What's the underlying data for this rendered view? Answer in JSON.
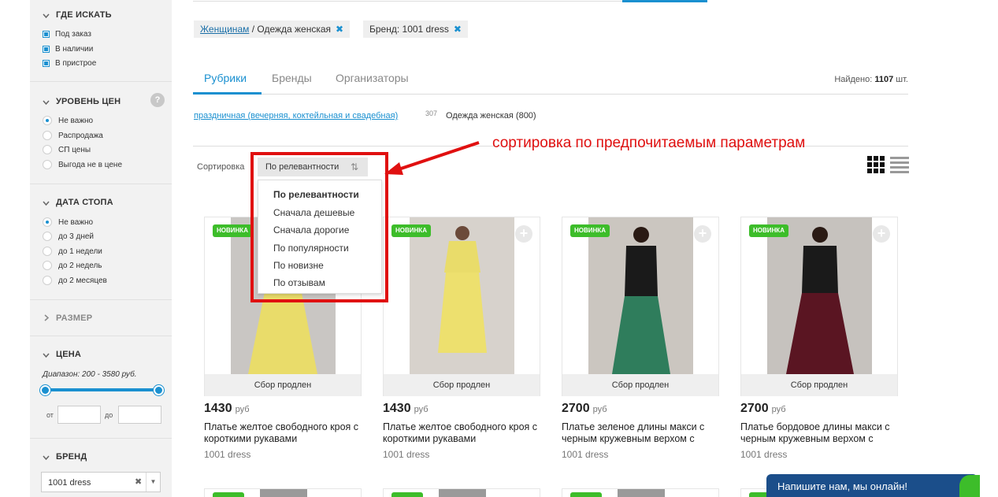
{
  "sidebar": {
    "where": {
      "title": "ГДЕ ИСКАТЬ",
      "options": [
        "Под заказ",
        "В наличии",
        "В пристрое"
      ]
    },
    "price_level": {
      "title": "УРОВЕНЬ ЦЕН",
      "help": "?",
      "options": [
        "Не важно",
        "Распродажа",
        "СП цены",
        "Выгода не в цене"
      ]
    },
    "stop_date": {
      "title": "ДАТА СТОПА",
      "options": [
        "Не важно",
        "до 3 дней",
        "до 1 недели",
        "до 2 недель",
        "до 2 месяцев"
      ]
    },
    "size": {
      "title": "РАЗМЕР"
    },
    "price": {
      "title": "ЦЕНА",
      "range": "Диапазон: 200 - 3580 руб.",
      "from": "от",
      "to": "до"
    },
    "brand": {
      "title": "БРЕНД",
      "value": "1001 dress",
      "clear": "✖",
      "dropdown": "▼"
    }
  },
  "filters": {
    "chip1_link": "Женщинам",
    "chip1_rest": " / Одежда женская",
    "chip2": "Бренд: 1001 dress",
    "remove": "✖"
  },
  "tabs": [
    "Рубрики",
    "Бренды",
    "Организаторы"
  ],
  "found": {
    "label": "Найдено: ",
    "count": "1107",
    "unit": " шт."
  },
  "rubrics": {
    "link": "праздничная (вечерняя, коктейльная и свадебная)",
    "count": "307",
    "plain": "Одежда женская (800)"
  },
  "sort": {
    "label": "Сортировка",
    "current": "По релевантности",
    "icon": "⇅",
    "options": [
      "По релевантности",
      "Сначала дешевые",
      "Сначала дорогие",
      "По популярности",
      "По новизне",
      "По отзывам"
    ]
  },
  "annotation": "сортировка по предпочитаемым параметрам",
  "products": [
    {
      "badge": "НОВИНКА",
      "footer": "Сбор продлен",
      "price": "1430",
      "currency": "руб",
      "name": "Платье желтое свободного кроя с короткими рукавами",
      "brand": "1001 dress",
      "dress_color": "#e9dc6a",
      "top_color": "#e9dc6a"
    },
    {
      "badge": "НОВИНКА",
      "footer": "Сбор продлен",
      "price": "1430",
      "currency": "руб",
      "name": "Платье желтое свободного кроя с короткими рукавами",
      "brand": "1001 dress",
      "dress_color": "#e9dc6a",
      "top_color": "#e9dc6a"
    },
    {
      "badge": "НОВИНКА",
      "footer": "Сбор продлен",
      "price": "2700",
      "currency": "руб",
      "name": "Платье зеленое длины макси с черным кружевным верхом с",
      "brand": "1001 dress",
      "dress_color": "#2f7d5c",
      "top_color": "#1a1a1a"
    },
    {
      "badge": "НОВИНКА",
      "footer": "Сбор продлен",
      "price": "2700",
      "currency": "руб",
      "name": "Платье бордовое длины макси с черным кружевным верхом с",
      "brand": "1001 dress",
      "dress_color": "#5a1522",
      "top_color": "#1a1a1a"
    }
  ],
  "chat": "Напишите нам, мы онлайн!",
  "colors": {
    "accent": "#1a90d0",
    "badge": "#3dbd2a",
    "annotation": "#e01010",
    "chat": "#1b4e8a"
  }
}
